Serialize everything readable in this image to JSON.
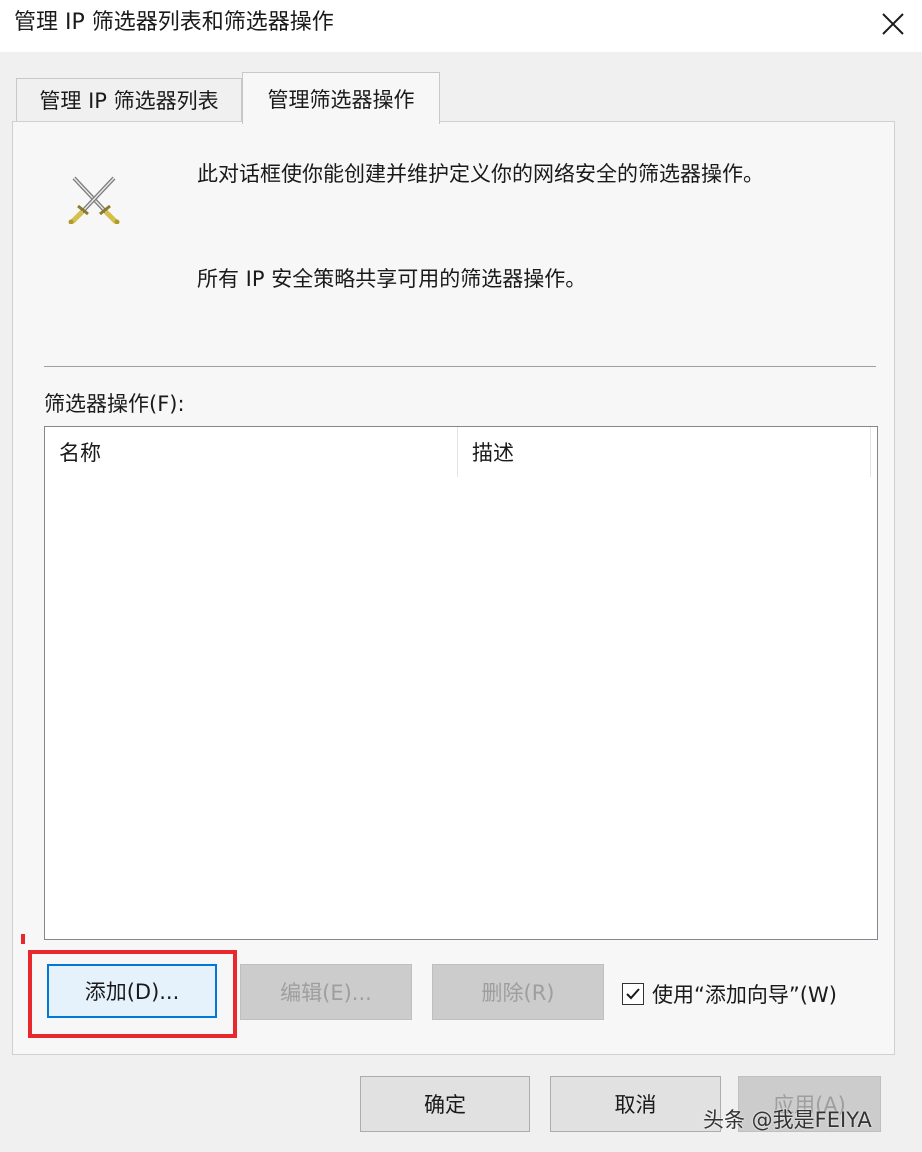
{
  "window": {
    "title": "管理 IP 筛选器列表和筛选器操作"
  },
  "tabs": [
    {
      "label": "管理 IP 筛选器列表"
    },
    {
      "label": "管理筛选器操作"
    }
  ],
  "description": {
    "line1": "此对话框使你能创建并维护定义你的网络安全的筛选器操作。",
    "line2": "所有 IP 安全策略共享可用的筛选器操作。"
  },
  "filter_actions": {
    "label": "筛选器操作(F):",
    "columns": [
      "名称",
      "描述"
    ],
    "rows": []
  },
  "buttons": {
    "add": "添加(D)...",
    "edit": "编辑(E)...",
    "delete": "删除(R)",
    "ok": "确定",
    "cancel": "取消",
    "apply": "应用(A)"
  },
  "wizard_checkbox": {
    "label": "使用“添加向导”(W)",
    "checked": true
  },
  "watermark": "头条 @我是FEIYA",
  "colors": {
    "focus_blue": "#0078d7",
    "highlight_red": "#e8282d"
  }
}
